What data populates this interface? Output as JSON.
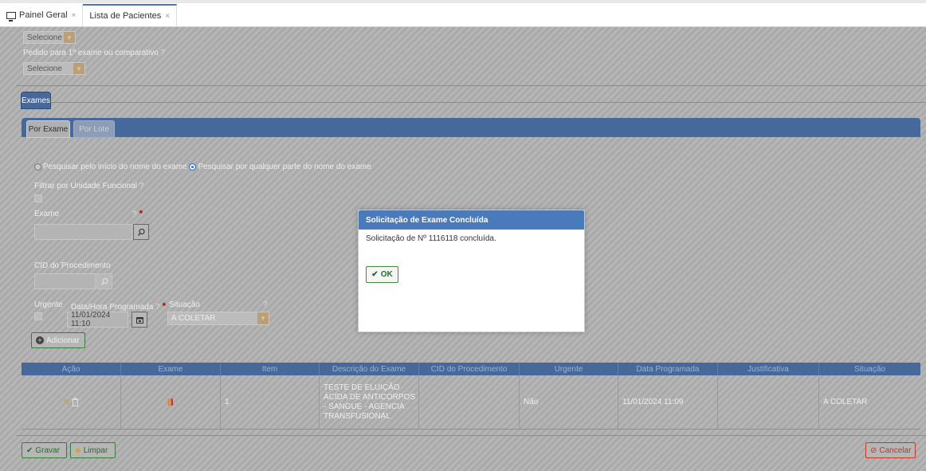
{
  "tabs": [
    {
      "label": "Painel Geral",
      "close": "×"
    },
    {
      "label": "Lista de Pacientes",
      "close": "×"
    }
  ],
  "form": {
    "select1_value": "Selecione",
    "pedido_label": "Pedido para 1º exame ou comparativo",
    "help": "?",
    "select2_value": "Selecione"
  },
  "section_tab": "Exames",
  "subtabs": {
    "por_exame": "Por Exame",
    "por_lote": "Por Lote"
  },
  "search": {
    "radio1": "Pesquisar pelo início do nome do exame",
    "radio2": "Pesquisar por qualquer parte do nome do exame",
    "radio_selected": "radio2",
    "filtrar_label": "Filtrar por Unidade Funcional",
    "exame_label": "Exame",
    "required": "*",
    "cid_label": "CID do Procedimento",
    "urgente_label": "Urgente",
    "data_label": "Data/Hora Programada",
    "data_value": "11/01/2024 11:10",
    "situacao_label": "Situação",
    "situacao_value": "A COLETAR",
    "adicionar": "Adicionar"
  },
  "table": {
    "headers": [
      "Ação",
      "Exame",
      "Item",
      "Descrição do Exame",
      "CID do Procedimento",
      "Urgente",
      "Data Programada",
      "Justificativa",
      "Situação"
    ],
    "rows": [
      {
        "item": "1",
        "descricao": "TESTE DE ELUIÇÃO ÁCIDA DE ANTICORPOS - SANGUE - AGENCIA TRANSFUSIONAL",
        "cid": "",
        "urgente": "Não",
        "data": "11/01/2024 11:09",
        "justificativa": "",
        "situacao": "A COLETAR"
      }
    ]
  },
  "footer": {
    "gravar": "Gravar",
    "limpar": "Limpar",
    "cancelar": "Cancelar"
  },
  "dialog": {
    "title": "Solicitação de Exame Concluída",
    "message": "Solicitação de Nº 1116118 concluída.",
    "ok": "OK"
  },
  "colors": {
    "accent": "#4a7ab9",
    "header_blue": "#46689a",
    "ok_green": "#2a6b2a",
    "cancel_red": "#c0392b"
  }
}
